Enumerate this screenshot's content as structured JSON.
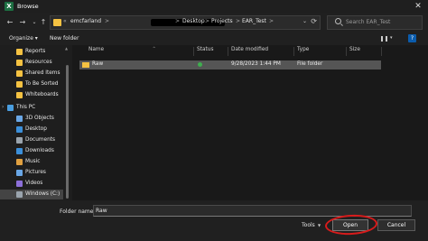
{
  "window": {
    "title": "Browse",
    "app_icon": "X",
    "close_glyph": "✕"
  },
  "nav_buttons": {
    "back": "←",
    "forward": "→",
    "up": "↑"
  },
  "address": {
    "crumbs": [
      "emcfarland",
      "Desktop",
      "Projects",
      "EAR_Test"
    ],
    "separator": ">",
    "dropdown": "⌄",
    "refresh": "⟳"
  },
  "search": {
    "placeholder": "Search EAR_Test"
  },
  "toolbar": {
    "organize": "Organize ▾",
    "new_folder": "New folder",
    "help": "?"
  },
  "nav_pane": {
    "items": [
      {
        "label": "Reports",
        "icon": "folder-icon",
        "color": "#f5c242"
      },
      {
        "label": "Resources",
        "icon": "folder-icon",
        "color": "#f5c242"
      },
      {
        "label": "Shared Items",
        "icon": "folder-icon",
        "color": "#f5c242"
      },
      {
        "label": "To Be Sorted",
        "icon": "folder-icon",
        "color": "#f5c242"
      },
      {
        "label": "Whiteboards",
        "icon": "folder-icon",
        "color": "#f5c242"
      },
      {
        "label": "This PC",
        "icon": "computer-icon",
        "color": "#4a9ee0"
      },
      {
        "label": "3D Objects",
        "icon": "cube-icon",
        "color": "#6aa7e6"
      },
      {
        "label": "Desktop",
        "icon": "desktop-icon",
        "color": "#3b8fd9"
      },
      {
        "label": "Documents",
        "icon": "document-icon",
        "color": "#9aa4ad"
      },
      {
        "label": "Downloads",
        "icon": "download-icon",
        "color": "#3b8fd9"
      },
      {
        "label": "Music",
        "icon": "music-icon",
        "color": "#e0a040"
      },
      {
        "label": "Pictures",
        "icon": "picture-icon",
        "color": "#6aa7e6"
      },
      {
        "label": "Videos",
        "icon": "video-icon",
        "color": "#8c6fd8"
      },
      {
        "label": "Windows (C:)",
        "icon": "drive-icon",
        "color": "#9aa4ad"
      }
    ]
  },
  "columns": {
    "name": "Name",
    "status": "Status",
    "date": "Date modified",
    "type": "Type",
    "size": "Size"
  },
  "files": [
    {
      "name": "Raw",
      "status": "synced",
      "date": "9/28/2023 1:44 PM",
      "type": "File folder",
      "size": ""
    }
  ],
  "bottom": {
    "folder_name_label": "Folder name:",
    "folder_name_value": "Raw",
    "tools_label": "Tools",
    "tools_dd": "▼",
    "open_label": "Open",
    "cancel_label": "Cancel"
  },
  "colors": {
    "folder": "#f5c242",
    "annotation": "#d81b1b",
    "sync_ok": "#3fae4f"
  }
}
